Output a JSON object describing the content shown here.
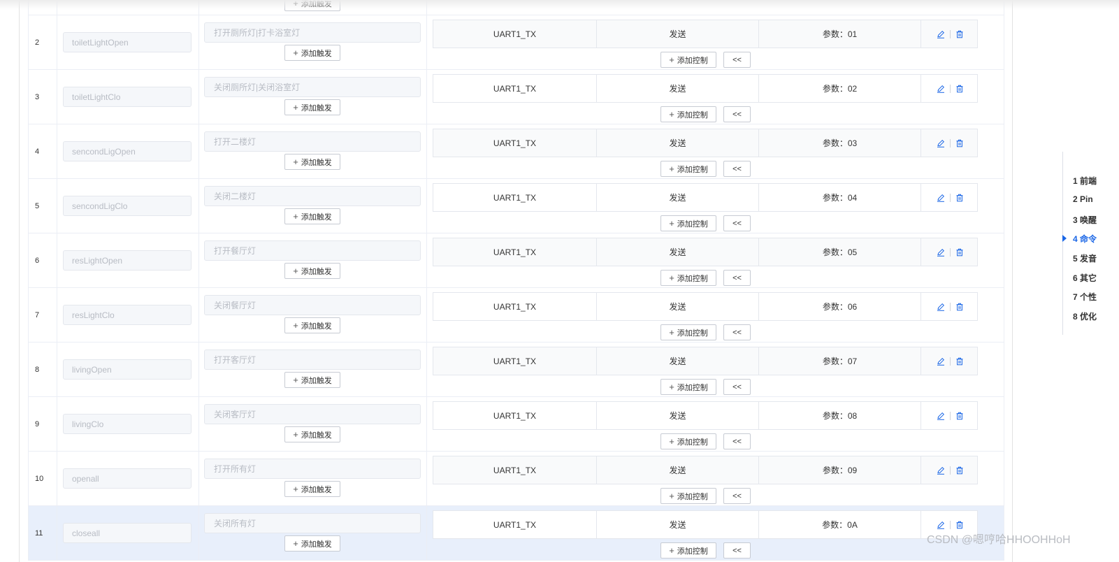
{
  "accent_color": "#1a66e6",
  "table": {
    "add_trigger_label": "添加触发",
    "add_control_label": "添加控制",
    "collapse_label": "<<",
    "rows": [
      {
        "index": "2",
        "name": "toiletLightOpen",
        "trigger": "打开厕所灯|打卡浴室灯",
        "port": "UART1_TX",
        "action": "发送",
        "param": "参数：01"
      },
      {
        "index": "3",
        "name": "toiletLightClo",
        "trigger": "关闭厕所灯|关闭浴室灯",
        "port": "UART1_TX",
        "action": "发送",
        "param": "参数：02"
      },
      {
        "index": "4",
        "name": "sencondLigOpen",
        "trigger": "打开二楼灯",
        "port": "UART1_TX",
        "action": "发送",
        "param": "参数：03"
      },
      {
        "index": "5",
        "name": "sencondLigClo",
        "trigger": "关闭二楼灯",
        "port": "UART1_TX",
        "action": "发送",
        "param": "参数：04"
      },
      {
        "index": "6",
        "name": "resLightOpen",
        "trigger": "打开餐厅灯",
        "port": "UART1_TX",
        "action": "发送",
        "param": "参数：05"
      },
      {
        "index": "7",
        "name": "resLightClo",
        "trigger": "关闭餐厅灯",
        "port": "UART1_TX",
        "action": "发送",
        "param": "参数：06"
      },
      {
        "index": "8",
        "name": "livingOpen",
        "trigger": "打开客厅灯",
        "port": "UART1_TX",
        "action": "发送",
        "param": "参数：07"
      },
      {
        "index": "9",
        "name": "livingClo",
        "trigger": "关闭客厅灯",
        "port": "UART1_TX",
        "action": "发送",
        "param": "参数：08"
      },
      {
        "index": "10",
        "name": "openall",
        "trigger": "打开所有灯",
        "port": "UART1_TX",
        "action": "发送",
        "param": "参数：09"
      },
      {
        "index": "11",
        "name": "closeall",
        "trigger": "关闭所有灯",
        "port": "UART1_TX",
        "action": "发送",
        "param": "参数：0A"
      }
    ]
  },
  "outline": {
    "items": [
      {
        "label": "1 前端"
      },
      {
        "label": "2 Pin"
      },
      {
        "label": "3 唤醒"
      },
      {
        "label": "4 命令"
      },
      {
        "label": "5 发音"
      },
      {
        "label": "6 其它"
      },
      {
        "label": "7 个性"
      },
      {
        "label": "8 优化"
      }
    ],
    "active_index": 3
  },
  "watermark": "CSDN @嗯哼哈HHOOHHoH"
}
